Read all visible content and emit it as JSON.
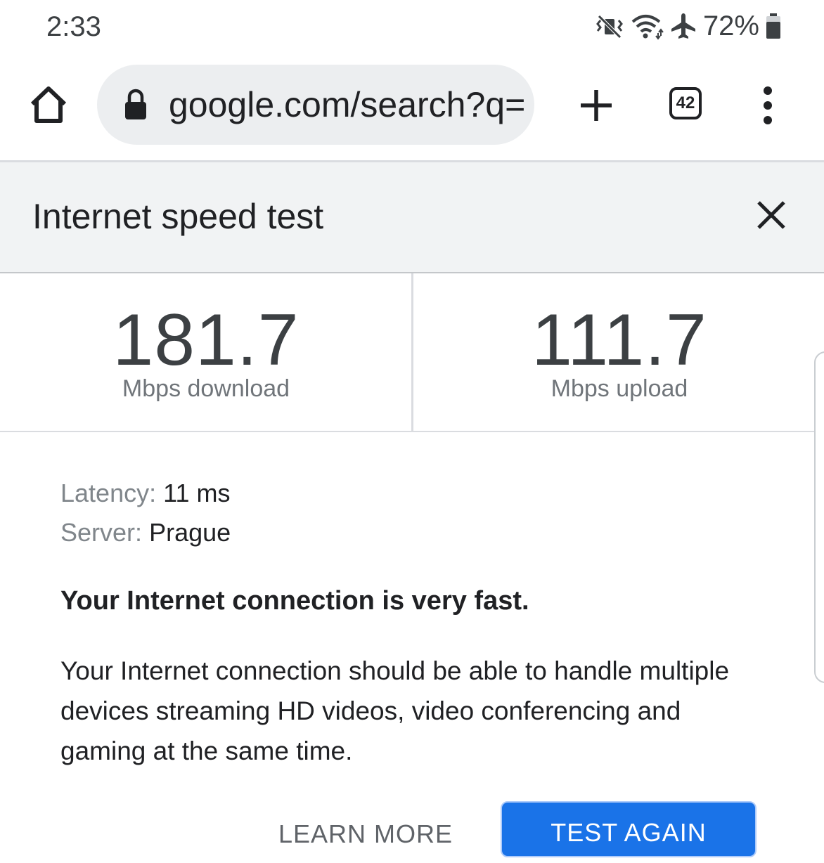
{
  "status_bar": {
    "time": "2:33",
    "battery_percent": "72%",
    "icons": [
      "vibrate-mute-icon",
      "wifi-icon",
      "airplane-mode-icon",
      "battery-icon"
    ]
  },
  "browser": {
    "url": "google.com/search?q=",
    "tab_count": "42",
    "icons": [
      "home-icon",
      "lock-icon",
      "plus-icon",
      "tab-switcher-icon",
      "more-vert-icon"
    ]
  },
  "speed_test": {
    "title": "Internet speed test",
    "download": {
      "value": "181.7",
      "label": "Mbps download"
    },
    "upload": {
      "value": "111.7",
      "label": "Mbps upload"
    },
    "latency": {
      "key": "Latency:",
      "value": "11 ms"
    },
    "server": {
      "key": "Server:",
      "value": "Prague"
    },
    "verdict": "Your Internet connection is very fast.",
    "description": "Your Internet connection should be able to handle multiple devices streaming HD videos, video conferencing and gaming at the same time.",
    "learn_more_label": "LEARN MORE",
    "test_again_label": "TEST AGAIN"
  },
  "colors": {
    "accent": "#1a73e8",
    "header_bg": "#f1f3f4",
    "url_bar_bg": "#eceef0",
    "text_primary": "#202124",
    "text_secondary": "#70757a"
  }
}
